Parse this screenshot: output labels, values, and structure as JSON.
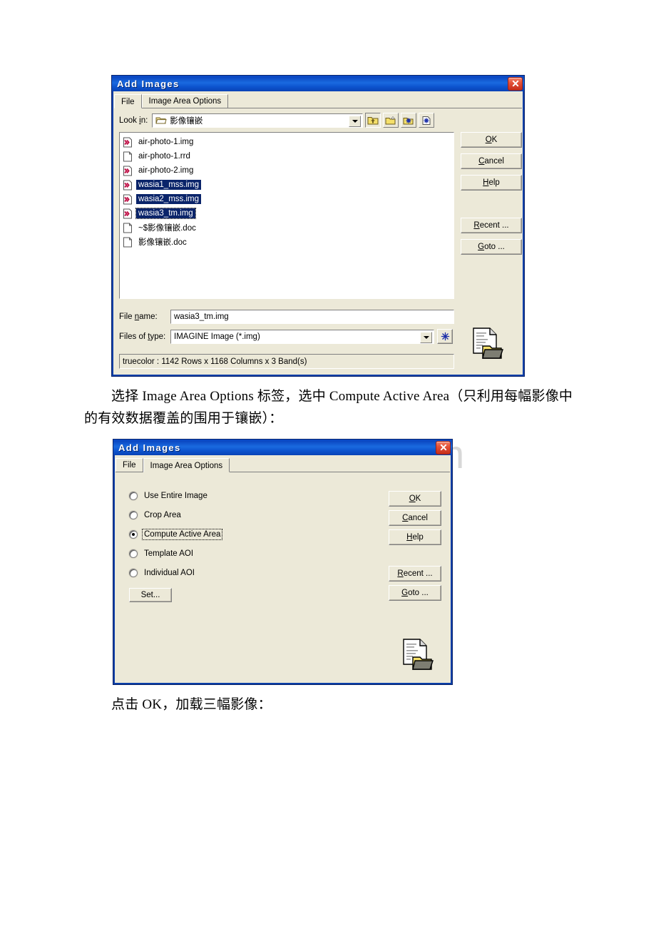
{
  "page": {
    "watermark": "www.bingdoc.com",
    "paragraph_1": "选择 Image Area Options 标签，选中 Compute Active Area（只利用每幅影像中的有效数据覆盖的围用于镶嵌）：",
    "paragraph_2": "点击 OK，加载三幅影像："
  },
  "dialog_file": {
    "title": "Add Images",
    "close_label": "close-icon",
    "tabs": [
      {
        "label": "File",
        "active": true
      },
      {
        "label": "Image Area Options",
        "active": false
      }
    ],
    "lookin": {
      "label": "Look in:",
      "value": "影像镶嵌",
      "icon": "open-folder-icon"
    },
    "toolbar": [
      {
        "name": "up-one-level-icon",
        "title": "Up One Level"
      },
      {
        "name": "create-new-folder-icon",
        "title": "Create New Folder"
      },
      {
        "name": "folder-star-icon",
        "title": "Folder Options"
      },
      {
        "name": "page-star-icon",
        "title": "File Options"
      }
    ],
    "files": [
      {
        "name": "air-photo-1.img",
        "icon": "img-file-icon",
        "selected": false
      },
      {
        "name": "air-photo-1.rrd",
        "icon": "generic-file-icon",
        "selected": false
      },
      {
        "name": "air-photo-2.img",
        "icon": "img-file-icon",
        "selected": false
      },
      {
        "name": "wasia1_mss.img",
        "icon": "img-file-icon",
        "selected": true
      },
      {
        "name": "wasia2_mss.img",
        "icon": "img-file-icon",
        "selected": true
      },
      {
        "name": "wasia3_tm.img",
        "icon": "img-file-icon",
        "selected": true,
        "focused": true
      },
      {
        "name": "~$影像镶嵌.doc",
        "icon": "generic-file-icon",
        "selected": false
      },
      {
        "name": "影像镶嵌.doc",
        "icon": "generic-file-icon",
        "selected": false
      }
    ],
    "file_name": {
      "label": "File name:",
      "value": "wasia3_tm.img"
    },
    "files_of_type": {
      "label": "Files of type:",
      "value": "IMAGINE Image (*.img)"
    },
    "status": "truecolor : 1142 Rows x 1168 Columns x 3 Band(s)",
    "buttons": [
      {
        "label": "OK",
        "accel": "O"
      },
      {
        "label": "Cancel",
        "accel": "C"
      },
      {
        "label": "Help",
        "accel": "H"
      },
      {
        "label": "Recent ...",
        "accel": "R"
      },
      {
        "label": "Goto ...",
        "accel": "G"
      }
    ],
    "preview_icon": "document-folder-icon"
  },
  "dialog_area": {
    "title": "Add Images",
    "close_label": "close-icon",
    "tabs": [
      {
        "label": "File",
        "active": false
      },
      {
        "label": "Image Area Options",
        "active": true
      }
    ],
    "radio_options": [
      {
        "label": "Use Entire Image",
        "selected": false
      },
      {
        "label": "Crop Area",
        "selected": false
      },
      {
        "label": "Compute Active Area",
        "selected": true,
        "focused": true
      },
      {
        "label": "Template AOI",
        "selected": false
      },
      {
        "label": "Individual AOI",
        "selected": false
      }
    ],
    "set_button": "Set...",
    "buttons": [
      {
        "label": "OK",
        "accel": "O"
      },
      {
        "label": "Cancel",
        "accel": "C"
      },
      {
        "label": "Help",
        "accel": "H"
      },
      {
        "label": "Recent ...",
        "accel": "R"
      },
      {
        "label": "Goto ...",
        "accel": "G"
      }
    ],
    "preview_icon": "document-folder-icon"
  },
  "colors": {
    "title_blue": "#0b50d0",
    "dialog_face": "#ece9d8",
    "selection_blue": "#0a246a",
    "close_red": "#c62d1a",
    "watermark_grey": "#d8d8d8"
  }
}
